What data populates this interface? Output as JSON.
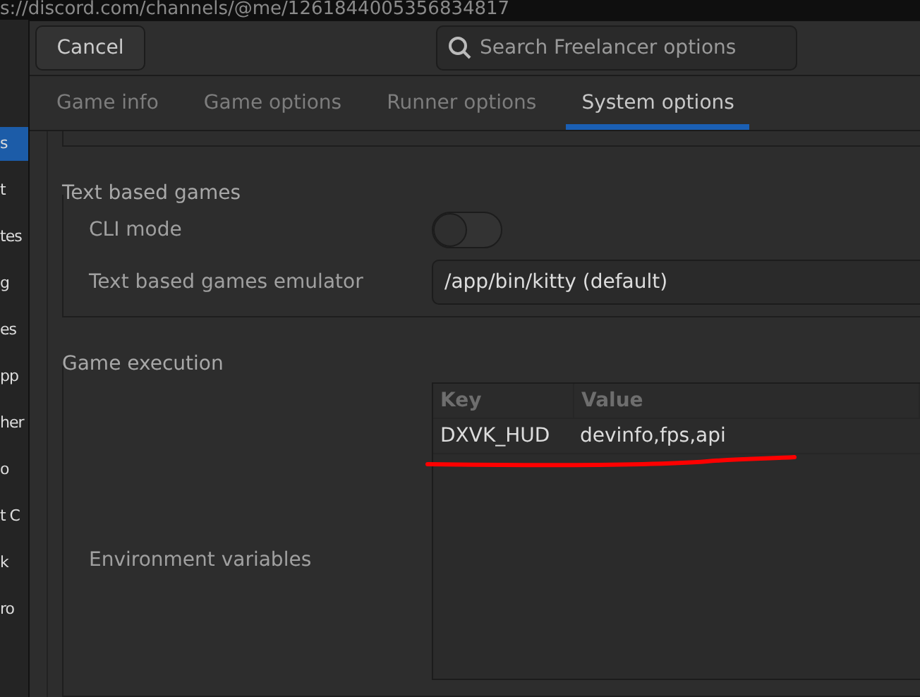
{
  "browser": {
    "url": "s://discord.com/channels/@me/1261844005356834817"
  },
  "sidebar": {
    "items": [
      {
        "label": "s",
        "selected": true
      },
      {
        "label": "t",
        "selected": false
      },
      {
        "label": "tes",
        "selected": false
      },
      {
        "label": "g",
        "selected": false
      },
      {
        "label": "es",
        "selected": false
      },
      {
        "label": "pp",
        "selected": false
      },
      {
        "label": "her",
        "selected": false
      },
      {
        "label": "o",
        "selected": false
      },
      {
        "label": "t C",
        "selected": false
      },
      {
        "label": "k",
        "selected": false
      },
      {
        "label": "ro",
        "selected": false
      }
    ]
  },
  "header": {
    "cancel": "Cancel",
    "search": {
      "placeholder": "Search Freelancer options"
    }
  },
  "tabs": [
    {
      "label": "Game info",
      "selected": false
    },
    {
      "label": "Game options",
      "selected": false
    },
    {
      "label": "Runner options",
      "selected": false
    },
    {
      "label": "System options",
      "selected": true
    }
  ],
  "sections": [
    {
      "title": "Text based games",
      "rows": [
        {
          "kind": "switch",
          "label": "CLI mode",
          "on": false
        },
        {
          "kind": "field",
          "label": "Text based games emulator",
          "value": "/app/bin/kitty (default)"
        }
      ]
    },
    {
      "title": "Game execution",
      "rows": [
        {
          "kind": "table",
          "label": "Environment variables",
          "columns": [
            "Key",
            "Value"
          ],
          "rows": [
            [
              "DXVK_HUD",
              "devinfo,fps,api"
            ]
          ]
        }
      ]
    }
  ]
}
